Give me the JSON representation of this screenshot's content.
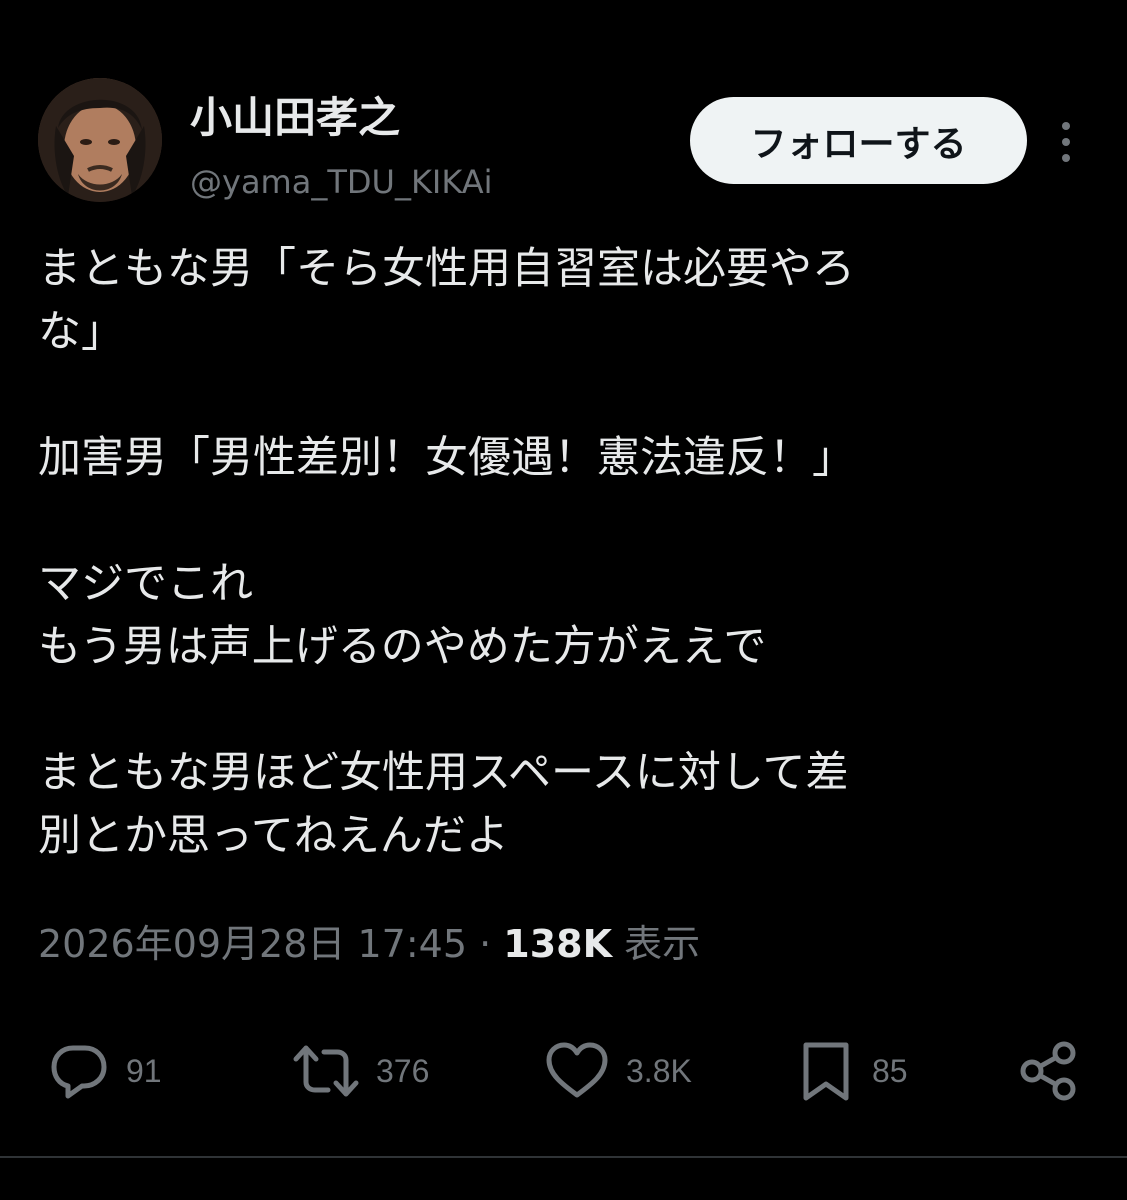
{
  "author": {
    "display_name": "小山田孝之",
    "handle": "@yama_TDU_KIKAi",
    "avatar_icon": "profile-photo"
  },
  "header": {
    "follow_label": "フォローする",
    "more_icon": "more-dots-vertical-icon"
  },
  "tweet": {
    "paragraphs": [
      "まともな男「そら女性用自習室は必要やろ\nな」",
      "加害男「男性差別！女優遇！憲法違反！」",
      "マジでこれ\nもう男は声上げるのやめた方がええで",
      "まともな男ほど女性用スペースに対して差\n別とか思ってねえんだよ"
    ]
  },
  "meta": {
    "timestamp": "2026年09月28日 17:45",
    "separator": "·",
    "views_count": "138K",
    "views_label": "表示"
  },
  "actions": {
    "reply": {
      "icon": "reply-bubble-icon",
      "count": "91"
    },
    "repost": {
      "icon": "repost-icon",
      "count": "376"
    },
    "like": {
      "icon": "heart-icon",
      "count": "3.8K"
    },
    "bookmark": {
      "icon": "bookmark-icon",
      "count": "85"
    },
    "share": {
      "icon": "share-icon"
    }
  },
  "colors": {
    "background": "#000000",
    "text_primary": "#e7e9ea",
    "text_secondary": "#71767b",
    "button_bg": "#eff3f4",
    "button_text": "#0f1419"
  }
}
